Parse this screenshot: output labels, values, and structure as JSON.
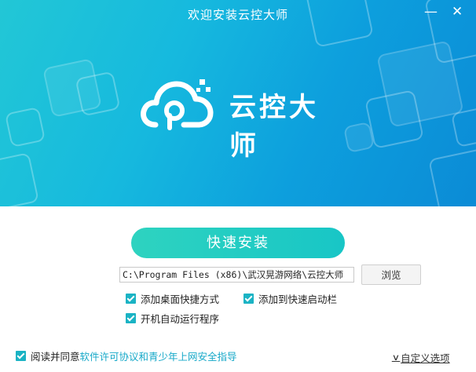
{
  "window": {
    "title": "欢迎安装云控大师",
    "minimize_label": "—",
    "close_label": "✕"
  },
  "brand": {
    "name": "云控大师",
    "logo_icon": "cloud-icon"
  },
  "install": {
    "button_label": "快速安装",
    "path_value": "C:\\Program Files (x86)\\武汉晃游网络\\云控大师",
    "browse_label": "浏览"
  },
  "options": {
    "desktop_shortcut": {
      "label": "添加桌面快捷方式",
      "checked": true
    },
    "quick_launch": {
      "label": "添加到快速启动栏",
      "checked": true
    },
    "autostart": {
      "label": "开机自动运行程序",
      "checked": true
    }
  },
  "footer": {
    "agree_prefix": "阅读并同意",
    "license_link": "软件许可协议",
    "and_text": "和",
    "youth_link": "青少年上网安全指导",
    "agree_checked": true,
    "custom_label": "自定义选项"
  },
  "colors": {
    "accent": "#1ab3c4",
    "banner_start": "#22c7d6",
    "banner_end": "#0b8bd6",
    "install_button": "#22cdc3",
    "link": "#15a8c8"
  }
}
